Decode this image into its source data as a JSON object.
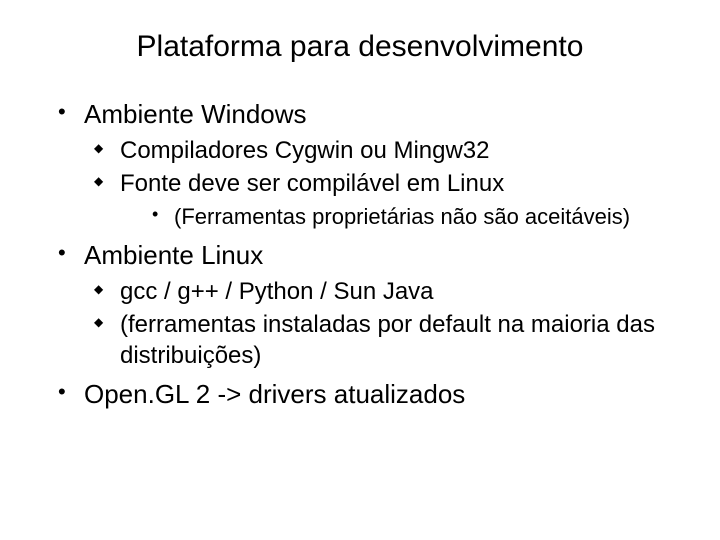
{
  "title": "Plataforma para desenvolvimento",
  "items": [
    {
      "text": "Ambiente Windows",
      "children": [
        {
          "text": "Compiladores Cygwin ou Mingw32"
        },
        {
          "text": "Fonte deve ser compilável em Linux",
          "children": [
            {
              "text": "(Ferramentas proprietárias não são aceitáveis)"
            }
          ]
        }
      ]
    },
    {
      "text": "Ambiente Linux",
      "children": [
        {
          "text": "gcc / g++ / Python / Sun Java"
        },
        {
          "text": "(ferramentas instaladas por default na maioria das distribuições)"
        }
      ]
    },
    {
      "text": "Open.GL 2 -> drivers atualizados"
    }
  ]
}
